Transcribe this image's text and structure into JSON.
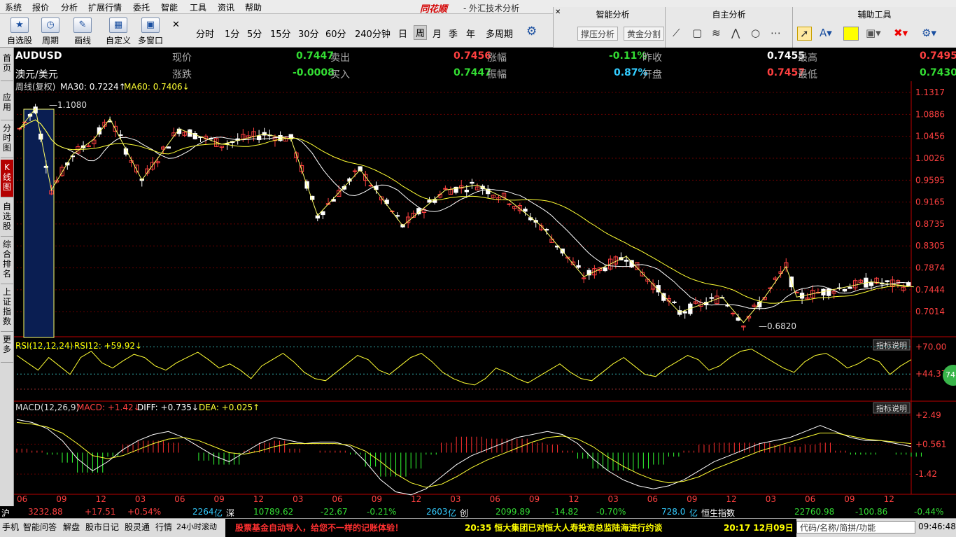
{
  "menu": [
    "系统",
    "报价",
    "分析",
    "扩展行情",
    "委托",
    "智能",
    "工具",
    "资讯",
    "帮助"
  ],
  "brand": "同花顺",
  "app_title": "- 外汇技术分析",
  "toolbar": {
    "buttons": [
      {
        "label": "自选股",
        "icon": "★"
      },
      {
        "label": "周期",
        "icon": "◷"
      },
      {
        "label": "画线",
        "icon": "✎"
      },
      {
        "label": "自定义",
        "icon": "▦"
      },
      {
        "label": "多窗口",
        "icon": "▣"
      }
    ],
    "periods": [
      "分时",
      "1分",
      "5分",
      "15分",
      "30分",
      "60分",
      "240分钟",
      "日",
      "周",
      "月",
      "季",
      "年",
      "多周期"
    ],
    "active_period": "周"
  },
  "panels": {
    "smart": {
      "title": "智能分析",
      "btn1": "撑压分析",
      "btn2": "黄金分割"
    },
    "self": {
      "title": "自主分析"
    },
    "aux": {
      "title": "辅助工具"
    }
  },
  "side_tabs": [
    "首页",
    "应用",
    "分时图",
    "K线图",
    "自选股",
    "综合排名",
    "上证指数",
    "更多"
  ],
  "active_side_tab": "K线图",
  "quote": {
    "symbol": "AUDUSD",
    "name": "澳元/美元",
    "labels": {
      "price": "现价",
      "change": "涨跌",
      "sell": "卖出",
      "buy": "买入",
      "pct": "涨幅",
      "amp": "振幅",
      "prev": "昨收",
      "open": "开盘",
      "high": "最高",
      "low": "最低"
    },
    "price": "0.7447",
    "change": "-0.0008",
    "sell": "0.7456",
    "buy": "0.7447",
    "pct": "-0.11%",
    "amp": "0.87%",
    "prev": "0.7455",
    "open": "0.7457",
    "high": "0.7495",
    "low": "0.7430"
  },
  "colors": {
    "up": "#ff4040",
    "down": "#ffffff",
    "ma30": "#ffffff",
    "ma60": "#ffff33",
    "green": "#33dd33",
    "cyan": "#33ccff",
    "yellow": "#ffff00"
  },
  "chart_data": [
    {
      "type": "candlestick",
      "title": "周线(复权)",
      "ma30_label": "MA30: 0.7224",
      "ma60_label": "MA60: 0.7406",
      "y_ticks": [
        "1.1317",
        "1.0886",
        "1.0456",
        "1.0026",
        "0.9595",
        "0.9165",
        "0.8735",
        "0.8305",
        "0.7874",
        "0.7444",
        "0.7014"
      ],
      "ylim": [
        0.67,
        1.1317
      ],
      "max_label": "1.1080",
      "min_label": "0.6820",
      "x_ticks": [
        "06",
        "09",
        "12",
        "03",
        "06",
        "09",
        "12",
        "03",
        "06",
        "09",
        "12",
        "03",
        "06",
        "09",
        "12",
        "03",
        "06",
        "09",
        "12",
        "03",
        "06",
        "09",
        "12"
      ],
      "close_path": [
        [
          0,
          1.06
        ],
        [
          3,
          1.1
        ],
        [
          6,
          0.94
        ],
        [
          10,
          1.01
        ],
        [
          14,
          1.04
        ],
        [
          17,
          1.08
        ],
        [
          23,
          0.96
        ],
        [
          30,
          1.06
        ],
        [
          38,
          1.03
        ],
        [
          46,
          1.05
        ],
        [
          51,
          1.04
        ],
        [
          56,
          0.89
        ],
        [
          64,
          0.98
        ],
        [
          72,
          0.87
        ],
        [
          80,
          0.94
        ],
        [
          86,
          0.95
        ],
        [
          92,
          0.92
        ],
        [
          98,
          0.87
        ],
        [
          106,
          0.77
        ],
        [
          114,
          0.81
        ],
        [
          124,
          0.7
        ],
        [
          132,
          0.73
        ],
        [
          136,
          0.68
        ],
        [
          140,
          0.73
        ],
        [
          144,
          0.79
        ],
        [
          146,
          0.73
        ],
        [
          160,
          0.76
        ],
        [
          168,
          0.75
        ]
      ]
    },
    {
      "type": "line",
      "title": "RSI(12,12,24)",
      "label": "RSI12: +59.92",
      "y_ticks": [
        "+70.00",
        "+44.37"
      ],
      "values": [
        62,
        55,
        48,
        60,
        52,
        44,
        60,
        66,
        55,
        50,
        57,
        63,
        60,
        52,
        48,
        55,
        60,
        65,
        58,
        50,
        54,
        48,
        40,
        52,
        58,
        64,
        56,
        46,
        40,
        38,
        46,
        54,
        62,
        58,
        48,
        44,
        52,
        60,
        64,
        56,
        46,
        40,
        36,
        34,
        40,
        50,
        46,
        40,
        36,
        42,
        48,
        54,
        46,
        40,
        38,
        46,
        54,
        60,
        52,
        44,
        42,
        50,
        56,
        62,
        58,
        48,
        52,
        60,
        66,
        68,
        62,
        56,
        50,
        46,
        56,
        62,
        64,
        58,
        50,
        54,
        60,
        56,
        44,
        52,
        58
      ]
    },
    {
      "type": "macd",
      "title": "MACD(12,26,9)",
      "macd_label": "MACD: +1.42",
      "diff_label": "DIFF: +0.735",
      "dea_label": "DEA: +0.025",
      "y_ticks": [
        "+2.49",
        "+0.561",
        "-1.42"
      ],
      "diff": [
        2.2,
        2.0,
        1.6,
        0.8,
        -0.4,
        -1.2,
        -0.6,
        0.2,
        0.8,
        1.2,
        1.4,
        1.0,
        0.4,
        -0.2,
        -0.6,
        0.0,
        0.6,
        1.0,
        0.8,
        0.6,
        0.7,
        0.7,
        0.4,
        -0.6,
        -1.8,
        -2.6,
        -2.8,
        -2.4,
        -1.6,
        -0.8,
        -0.2,
        0.2,
        0.6,
        1.0,
        1.2,
        1.4,
        1.2,
        0.6,
        -0.4,
        -1.2,
        -1.8,
        -2.2,
        -2.4,
        -2.2,
        -1.8,
        -1.2,
        -0.6,
        -0.2,
        0.2,
        0.6,
        0.8,
        1.0,
        1.4,
        1.8,
        1.4,
        1.0,
        0.8,
        0.8,
        0.6,
        0.4
      ],
      "dea": [
        2.0,
        1.9,
        1.7,
        1.3,
        0.6,
        -0.2,
        -0.4,
        -0.2,
        0.2,
        0.6,
        0.9,
        1.0,
        0.8,
        0.4,
        0.0,
        -0.1,
        0.1,
        0.4,
        0.6,
        0.6,
        0.6,
        0.6,
        0.5,
        0.1,
        -0.6,
        -1.4,
        -2.0,
        -2.3,
        -2.1,
        -1.6,
        -1.0,
        -0.5,
        -0.1,
        0.3,
        0.7,
        1.0,
        1.1,
        0.9,
        0.4,
        -0.3,
        -0.9,
        -1.4,
        -1.8,
        -2.0,
        -1.9,
        -1.6,
        -1.1,
        -0.7,
        -0.3,
        0.1,
        0.4,
        0.7,
        1.0,
        1.3,
        1.3,
        1.1,
        0.9,
        0.8,
        0.7,
        0.6
      ]
    }
  ],
  "legend_btn": "指标说明",
  "status": {
    "sh": {
      "name": "沪",
      "val": "3232.88",
      "chg": "+17.51",
      "pct": "+0.54%",
      "amt": "2264",
      "unit": "亿"
    },
    "sz": {
      "name": "深",
      "val": "10789.62",
      "chg": "-22.67",
      "pct": "-0.21%",
      "amt": "2603",
      "unit": "亿"
    },
    "cy": {
      "name": "创",
      "val": "2099.89",
      "chg": "-14.82",
      "pct": "-0.70%",
      "amt": "728.0",
      "unit": "亿"
    },
    "hs": {
      "name": "恒生指数",
      "val": "22760.98",
      "chg": "-100.86",
      "pct": "-0.44%"
    }
  },
  "bottom_tabs": [
    "手机",
    "智能问答",
    "解盘",
    "股市日记",
    "股灵通",
    "行情",
    "24小时滚动"
  ],
  "ticker1": "股票基金自动导入，给您不一样的记账体验！",
  "ticker2": "20:35 恒大集团已对恒大人寿投资总监陆海进行约谈",
  "ticker3": "20:17 12月09日",
  "search_placeholder": "代码/名称/简拼/功能",
  "clock": "09:46:48",
  "badge": "74"
}
